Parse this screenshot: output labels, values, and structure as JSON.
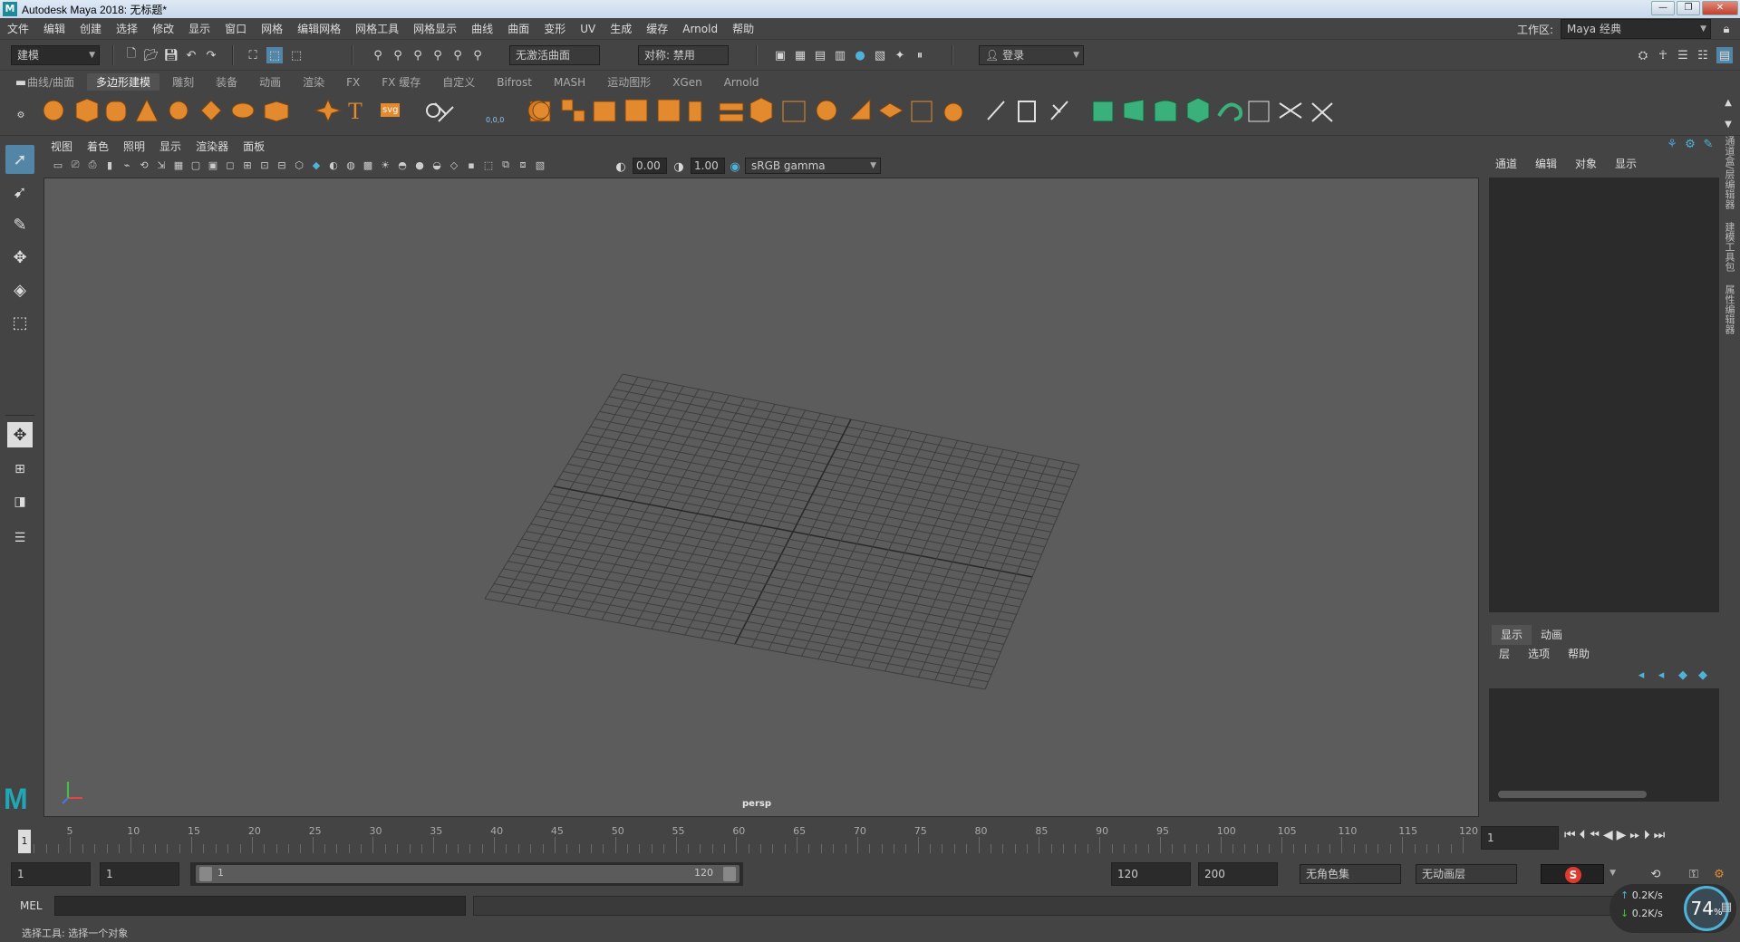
{
  "titlebar": {
    "title": "Autodesk Maya 2018: 无标题*",
    "logo": "M"
  },
  "menubar": {
    "items": [
      "文件",
      "编辑",
      "创建",
      "选择",
      "修改",
      "显示",
      "窗口",
      "网格",
      "编辑网格",
      "网格工具",
      "网格显示",
      "曲线",
      "曲面",
      "变形",
      "UV",
      "生成",
      "缓存",
      "Arnold",
      "帮助"
    ],
    "workspace_label": "工作区:",
    "workspace_value": "Maya 经典"
  },
  "statusline": {
    "mode": "建模",
    "surface_field": "无激活曲面",
    "symmetry": "对称: 禁用",
    "login": "登录"
  },
  "shelf": {
    "tabs": [
      "曲线/曲面",
      "多边形建模",
      "雕刻",
      "装备",
      "动画",
      "渲染",
      "FX",
      "FX 缓存",
      "自定义",
      "Bifrost",
      "MASH",
      "运动图形",
      "XGen",
      "Arnold"
    ],
    "active_tab": "多边形建模",
    "text_icons": {
      "type": "T",
      "svg": "svg",
      "coords": "0,0,0"
    }
  },
  "viewport": {
    "menu": [
      "视图",
      "着色",
      "照明",
      "显示",
      "渲染器",
      "面板"
    ],
    "exposure": "0.00",
    "gamma": "1.00",
    "colorspace": "sRGB gamma",
    "camera": "persp"
  },
  "channel_box": {
    "menu": [
      "通道",
      "编辑",
      "对象",
      "显示"
    ]
  },
  "layer_editor": {
    "tabs": [
      "显示",
      "动画"
    ],
    "active_tab": "显示",
    "menu": [
      "层",
      "选项",
      "帮助"
    ]
  },
  "side_tabs": [
    "通道盒/层编辑器",
    "建模工具包",
    "属性编辑器"
  ],
  "timeslider": {
    "ticks": [
      "5",
      "10",
      "15",
      "20",
      "25",
      "30",
      "35",
      "40",
      "45",
      "50",
      "55",
      "60",
      "65",
      "70",
      "75",
      "80",
      "85",
      "90",
      "95",
      "100",
      "105",
      "110",
      "115",
      "120"
    ],
    "current": "1",
    "current_frame_field": "1"
  },
  "range": {
    "start": "1",
    "playback_start": "1",
    "range_start": "1",
    "range_end": "120",
    "playback_end": "120",
    "end": "200",
    "character_set": "无角色集",
    "anim_layer": "无动画层"
  },
  "cmdline": {
    "label": "MEL"
  },
  "helpline": {
    "text": "选择工具: 选择一个对象"
  },
  "netmeter": {
    "up": "0.2K/s",
    "down": "0.2K/s",
    "percent": "74",
    "unit": "%"
  },
  "colors": {
    "accent": "#5285a6",
    "shelf_orange": "#e38a2e",
    "shelf_green": "#3ab07a"
  }
}
